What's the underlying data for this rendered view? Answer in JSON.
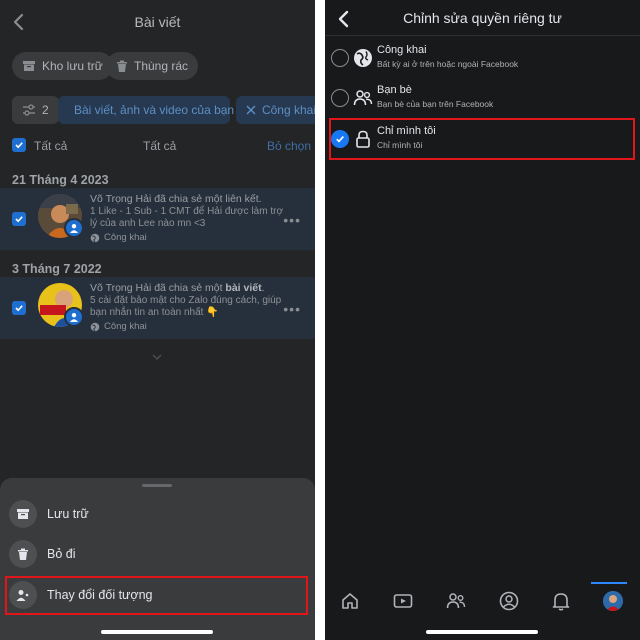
{
  "left": {
    "header": {
      "title": "Bài viết"
    },
    "buttons": {
      "archive": "Kho lưu trữ",
      "trash": "Thùng rác"
    },
    "filters": {
      "count": "2",
      "content": "Bài viết, ảnh và video của bạn",
      "audience": "Công khai"
    },
    "select_row": {
      "all_checkbox": "Tất cả",
      "center": "Tất cả",
      "deselect": "Bỏ chọn"
    },
    "groups": [
      {
        "date": "21 Tháng 4 2023",
        "post": {
          "author_line": "Võ Trọng Hải đã chia sẻ một liên kết.",
          "body": "1 Like - 1 Sub - 1 CMT để Hải được làm trợ lý của anh Lee nào mn <3",
          "audience": "Công khai"
        }
      },
      {
        "date": "3 Tháng 7 2022",
        "post": {
          "author_prefix": "Võ Trọng Hải đã chia sẻ một ",
          "author_bold": "bài viết",
          "author_suffix": ".",
          "body": "5 cài đặt bảo mật cho Zalo đúng cách, giúp bạn nhắn tin an toàn nhất 👇",
          "audience": "Công khai"
        }
      }
    ],
    "sheet": {
      "items": [
        {
          "label": "Lưu trữ",
          "icon": "archive-icon"
        },
        {
          "label": "Bỏ đi",
          "icon": "trash-icon"
        },
        {
          "label": "Thay đổi đối tượng",
          "icon": "audience-icon"
        }
      ]
    }
  },
  "right": {
    "header": {
      "title": "Chỉnh sửa quyền riêng tư"
    },
    "options": [
      {
        "title": "Công khai",
        "subtitle": "Bất kỳ ai ở trên hoặc ngoài Facebook",
        "icon": "globe-icon",
        "selected": false
      },
      {
        "title": "Bạn bè",
        "subtitle": "Bạn bè của bạn trên Facebook",
        "icon": "friends-icon",
        "selected": false
      },
      {
        "title": "Chỉ mình tôi",
        "subtitle": "Chỉ mình tôi",
        "icon": "lock-icon",
        "selected": true
      }
    ],
    "tabbar": [
      "home-icon",
      "video-icon",
      "friends-icon",
      "profile-icon",
      "bell-icon",
      "menu-avatar"
    ]
  },
  "colors": {
    "accent": "#1877f2",
    "highlight": "#e0161b",
    "panel_dark": "#18191a",
    "panel_dim": "#242526"
  }
}
